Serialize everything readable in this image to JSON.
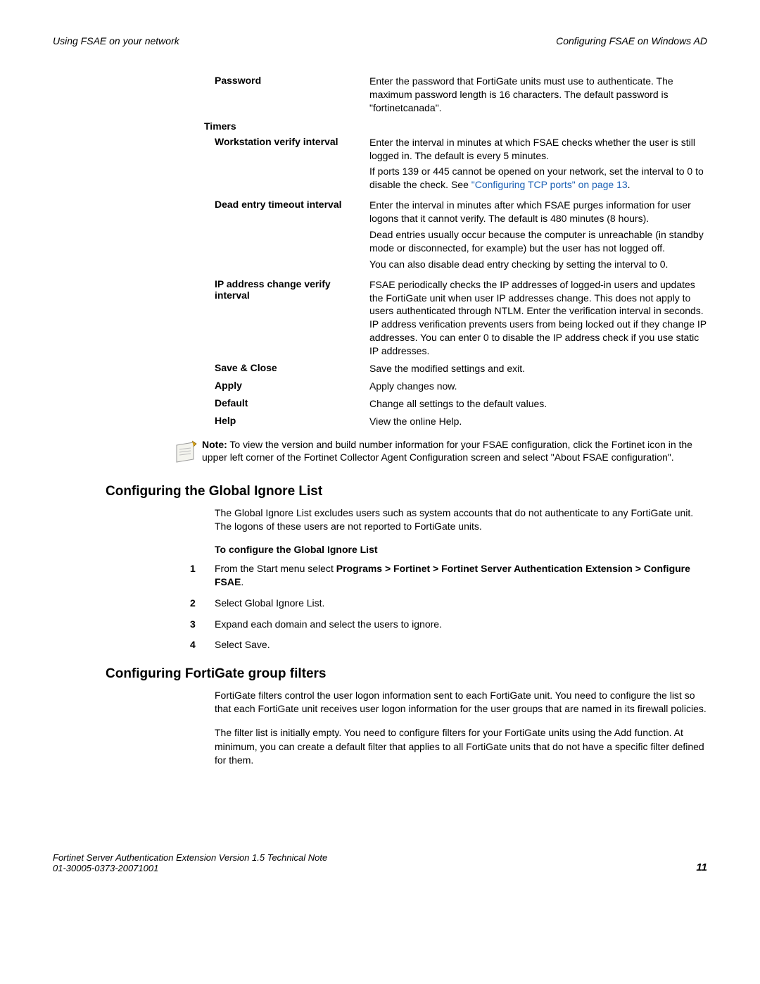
{
  "header": {
    "left": "Using FSAE on your network",
    "right": "Configuring FSAE on Windows AD"
  },
  "defs": {
    "password": {
      "label": "Password",
      "desc": "Enter the password that FortiGate units must use to authenticate. The maximum password length is 16 characters. The default password is \"fortinetcanada\"."
    },
    "timers_label": "Timers",
    "workstation": {
      "label": "Workstation verify interval",
      "p1": "Enter the interval in minutes at which FSAE checks whether the user is still logged in. The default is every 5 minutes.",
      "p2a": "If ports 139 or 445 cannot be opened on your network, set the interval to 0 to disable the check. See ",
      "p2link": "\"Configuring TCP ports\" on page 13",
      "p2b": "."
    },
    "dead": {
      "label": "Dead entry timeout interval",
      "p1": "Enter the interval in minutes after which FSAE purges information for user logons that it cannot verify. The default is 480 minutes (8 hours).",
      "p2": "Dead entries usually occur because the computer is unreachable (in standby mode or disconnected, for example) but the user has not logged off.",
      "p3": "You can also disable dead entry checking by setting the interval to 0."
    },
    "ip": {
      "label": "IP address change verify interval",
      "desc": "FSAE periodically checks the IP addresses of logged-in users and updates the FortiGate unit when user IP addresses change. This does not apply to users authenticated through NTLM. Enter the verification interval in seconds. IP address verification prevents users from being locked out if they change IP addresses. You can enter 0 to disable the IP address check if you use static IP addresses."
    },
    "save": {
      "label": "Save & Close",
      "desc": "Save the modified settings and exit."
    },
    "apply": {
      "label": "Apply",
      "desc": "Apply changes now."
    },
    "default": {
      "label": "Default",
      "desc": "Change all settings to the default values."
    },
    "help": {
      "label": "Help",
      "desc": "View the online Help."
    }
  },
  "note": {
    "bold": "Note:",
    "text": " To view the version and build number information for your FSAE configuration, click the Fortinet icon in the upper left corner of the Fortinet Collector Agent Configuration screen and select \"About FSAE configuration\"."
  },
  "section1": {
    "heading": "Configuring the Global Ignore List",
    "intro": "The Global Ignore List excludes users such as system accounts that do not authenticate to any FortiGate unit. The logons of these users are not reported to FortiGate units.",
    "sub": "To configure the Global Ignore List",
    "steps": {
      "s1a": "From the Start menu select ",
      "s1b": "Programs > Fortinet > Fortinet Server Authentication Extension > Configure FSAE",
      "s1c": ".",
      "s2": "Select Global Ignore List.",
      "s3": "Expand each domain and select the users to ignore.",
      "s4": "Select Save."
    }
  },
  "section2": {
    "heading": "Configuring FortiGate group filters",
    "p1": "FortiGate filters control the user logon information sent to each FortiGate unit. You need to configure the list so that each FortiGate unit receives user logon information for the user groups that are named in its firewall policies.",
    "p2": "The filter list is initially empty. You need to configure filters for your FortiGate units using the Add function. At minimum, you can create a default filter that applies to all FortiGate units that do not have a specific filter defined for them."
  },
  "footer": {
    "line1": "Fortinet Server Authentication Extension Version 1.5 Technical Note",
    "line2": "01-30005-0373-20071001",
    "page": "11"
  }
}
